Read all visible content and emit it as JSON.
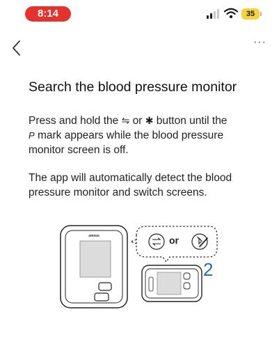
{
  "status_bar": {
    "time": "8:14",
    "battery": "35",
    "time_pill_color": "#e5322d",
    "battery_color": "#f7d23a"
  },
  "nav": {
    "back_icon": "chevron-left-icon",
    "more_label": "···"
  },
  "content": {
    "title": "Search the blood pressure monitor",
    "instruction": {
      "part1": "Press and hold the ",
      "icon1": "⇋",
      "part2": " or ",
      "icon2": "✱",
      "part3": " button until the",
      "icon3": "P",
      "part4": " mark appears while the blood pressure monitor screen is off."
    },
    "detect_text": "The app will automatically detect the blood pressure monitor and switch screens."
  },
  "illustration": {
    "device_brand": "omron",
    "or_label": "or",
    "step_number": "2",
    "step_color": "#2a6ab8"
  }
}
